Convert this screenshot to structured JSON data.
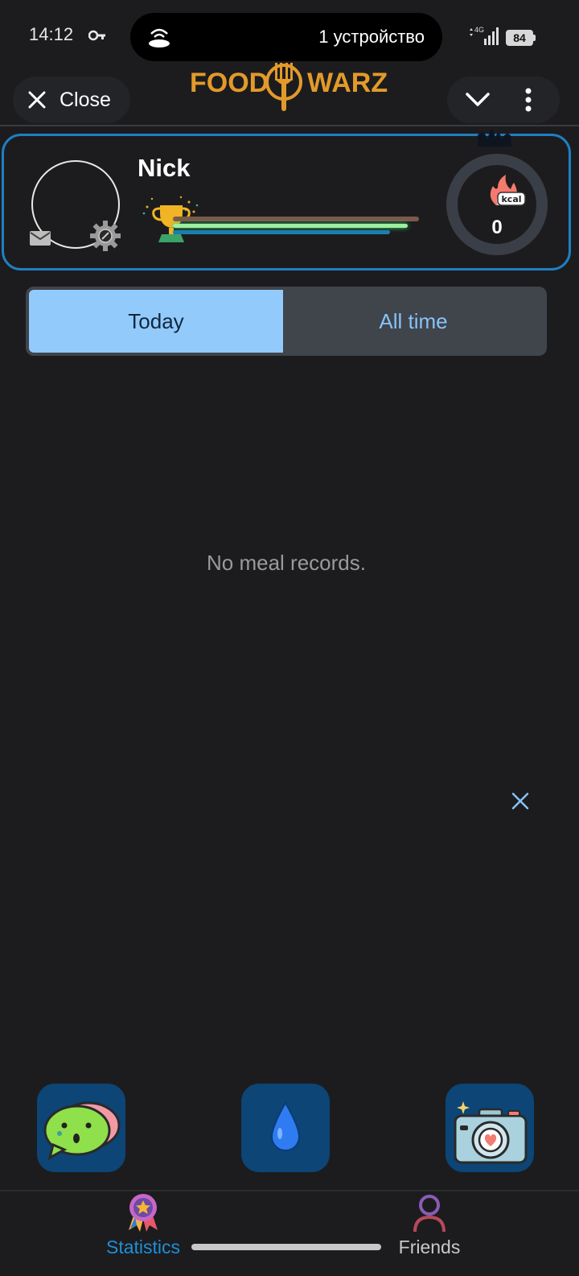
{
  "status_bar": {
    "time": "14:12",
    "device_text": "1 устройство",
    "network": "4G",
    "battery": "84",
    "icons": [
      "key-icon",
      "cast-icon",
      "signal-icon"
    ]
  },
  "header": {
    "close_label": "Close",
    "logo_left": "FOOD",
    "logo_right": "WARZ",
    "brand_color": "#e29a2a"
  },
  "profile": {
    "name": "Nick",
    "kcal": "0",
    "kcal_badge": "kcal",
    "accent": "#1f7fc2"
  },
  "tabs": {
    "today": "Today",
    "all_time": "All time",
    "selected": "Today"
  },
  "main": {
    "empty_message": "No meal records."
  },
  "bottom_nav": {
    "statistics": "Statistics",
    "friends": "Friends",
    "active": "Statistics"
  }
}
